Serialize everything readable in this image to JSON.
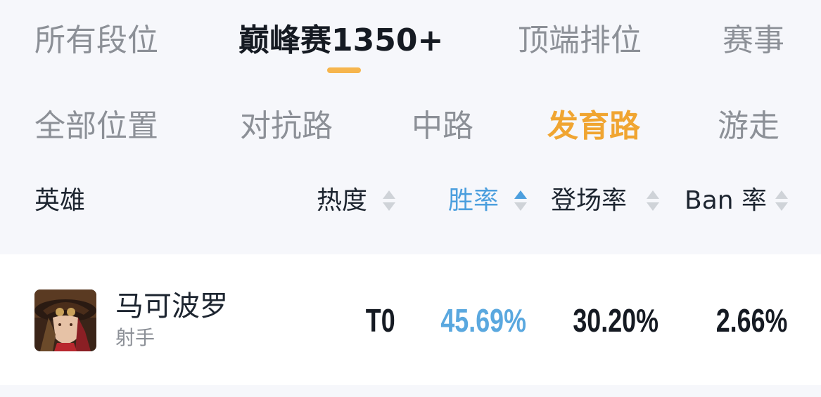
{
  "top_tabs": [
    {
      "label": "所有段位",
      "active": false
    },
    {
      "label": "巅峰赛1350+",
      "active": true
    },
    {
      "label": "顶端排位",
      "active": false
    },
    {
      "label": "赛事",
      "active": false
    }
  ],
  "position_tabs": [
    {
      "label": "全部位置",
      "active": false
    },
    {
      "label": "对抗路",
      "active": false
    },
    {
      "label": "中路",
      "active": false
    },
    {
      "label": "发育路",
      "active": true
    },
    {
      "label": "游走",
      "active": false
    }
  ],
  "columns": {
    "hero": "英雄",
    "heat": "热度",
    "win_rate": "胜率",
    "pick_rate": "登场率",
    "ban_rate": "Ban 率"
  },
  "sort": {
    "column": "win_rate",
    "direction": "ascending"
  },
  "rows": [
    {
      "name": "马可波罗",
      "role": "射手",
      "tier": "T0",
      "win_rate": "45.69%",
      "pick_rate": "30.20%",
      "ban_rate": "2.66%"
    }
  ],
  "colors": {
    "active_tab_underline": "#f6b54d",
    "active_position": "#f0a531",
    "sorted_column": "#4c9fde",
    "win_rate_value": "#5aa8df"
  },
  "icons": {
    "avatar": "hero-portrait",
    "sort": "sort-arrows-icon"
  }
}
